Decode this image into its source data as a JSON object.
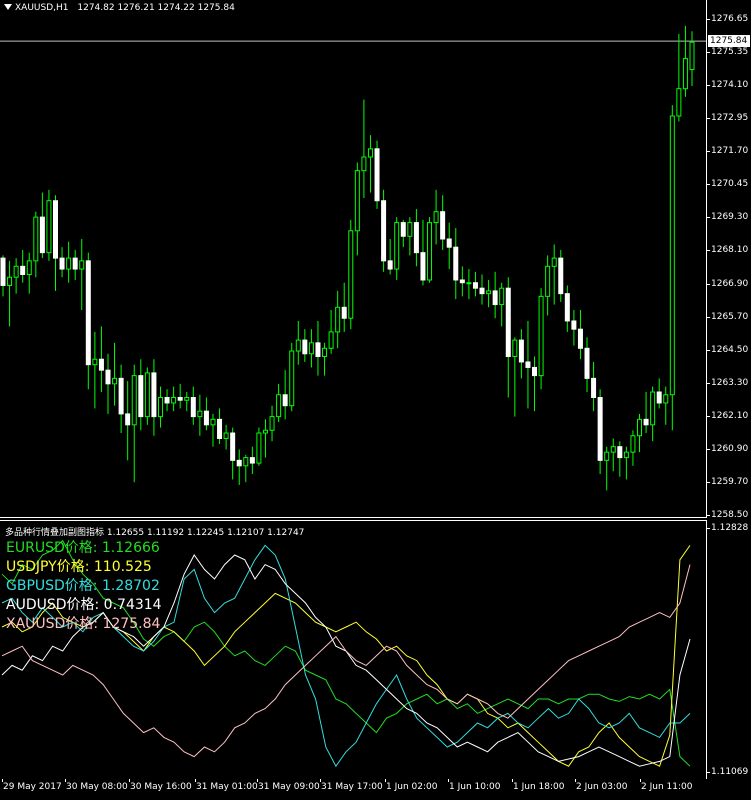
{
  "header": {
    "symbol": "XAUUSD,H1",
    "ohlc": "1274.82 1276.21 1274.22 1275.84"
  },
  "sub_header": {
    "text": "多品种行情叠加副图指标 1.12655 1.11192 1.12245 1.12107 1.12747"
  },
  "legend": [
    {
      "text": "EURUSD价格: 1.12666",
      "color": "#22dd22"
    },
    {
      "text": "USDJPY价格: 110.525",
      "color": "#ffff33"
    },
    {
      "text": "GBPUSD价格: 1.28702",
      "color": "#33dddd"
    },
    {
      "text": "AUDUSD价格: 0.74314",
      "color": "#ffffff"
    },
    {
      "text": "XAUUSD价格: 1275.84",
      "color": "#ffc0c0"
    }
  ],
  "price_axis": [
    "1276.65",
    "1275.35",
    "1274.10",
    "1272.95",
    "1271.70",
    "1270.45",
    "1269.30",
    "1268.10",
    "1266.90",
    "1265.70",
    "1264.50",
    "1263.30",
    "1262.10",
    "1260.90",
    "1259.70",
    "1258.50"
  ],
  "current_price": "1275.84",
  "sub_axis": {
    "top": "1.12828",
    "bottom": "1.11069"
  },
  "time_axis": [
    "29 May 2017",
    "30 May 08:00",
    "30 May 16:00",
    "31 May 01:00",
    "31 May 09:00",
    "31 May 17:00",
    "1 Jun 02:00",
    "1 Jun 10:00",
    "1 Jun 18:00",
    "2 Jun 03:00",
    "2 Jun 11:00"
  ],
  "colors": {
    "candle": "#00ff00",
    "background": "#000000",
    "price_line": "#c0c0c0"
  },
  "chart_data": {
    "type": "candlestick",
    "symbol": "XAUUSD",
    "timeframe": "H1",
    "ylim": [
      1258.5,
      1276.9
    ],
    "candles": [
      [
        1267.9,
        1268.0,
        1266.5,
        1266.9
      ],
      [
        1266.9,
        1267.8,
        1265.4,
        1267.2
      ],
      [
        1267.2,
        1267.9,
        1266.6,
        1267.6
      ],
      [
        1267.6,
        1268.2,
        1267.0,
        1267.3
      ],
      [
        1267.3,
        1268.1,
        1266.6,
        1267.8
      ],
      [
        1267.8,
        1269.6,
        1267.2,
        1269.4
      ],
      [
        1269.4,
        1270.3,
        1267.9,
        1268.1
      ],
      [
        1268.1,
        1270.4,
        1267.8,
        1270.0
      ],
      [
        1270.0,
        1270.2,
        1266.7,
        1267.9
      ],
      [
        1267.9,
        1268.3,
        1267.2,
        1267.5
      ],
      [
        1267.5,
        1268.5,
        1267.0,
        1267.9
      ],
      [
        1267.9,
        1268.2,
        1267.1,
        1267.5
      ],
      [
        1267.5,
        1268.6,
        1266.0,
        1267.8
      ],
      [
        1267.8,
        1268.1,
        1263.1,
        1264.0
      ],
      [
        1264.0,
        1265.2,
        1262.4,
        1264.2
      ],
      [
        1264.2,
        1265.4,
        1263.0,
        1263.8
      ],
      [
        1263.8,
        1264.4,
        1262.2,
        1263.3
      ],
      [
        1263.3,
        1264.8,
        1262.5,
        1263.5
      ],
      [
        1263.5,
        1264.0,
        1261.5,
        1262.2
      ],
      [
        1262.2,
        1263.4,
        1260.5,
        1261.8
      ],
      [
        1261.8,
        1264.0,
        1259.7,
        1263.6
      ],
      [
        1263.6,
        1264.2,
        1261.6,
        1262.1
      ],
      [
        1262.1,
        1263.9,
        1261.8,
        1263.7
      ],
      [
        1263.7,
        1264.2,
        1261.4,
        1262.1
      ],
      [
        1262.1,
        1263.2,
        1261.7,
        1262.8
      ],
      [
        1262.8,
        1263.1,
        1262.3,
        1262.6
      ],
      [
        1262.6,
        1263.2,
        1262.3,
        1262.8
      ],
      [
        1262.8,
        1263.3,
        1262.4,
        1262.7
      ],
      [
        1262.7,
        1263.0,
        1262.3,
        1262.8
      ],
      [
        1262.8,
        1263.2,
        1261.8,
        1262.1
      ],
      [
        1262.1,
        1262.9,
        1261.4,
        1262.3
      ],
      [
        1262.3,
        1262.8,
        1261.6,
        1261.8
      ],
      [
        1261.8,
        1262.2,
        1261.0,
        1262.0
      ],
      [
        1262.0,
        1262.4,
        1261.1,
        1261.3
      ],
      [
        1261.3,
        1261.8,
        1260.9,
        1261.5
      ],
      [
        1261.5,
        1261.7,
        1259.8,
        1260.5
      ],
      [
        1260.5,
        1260.9,
        1259.6,
        1260.3
      ],
      [
        1260.3,
        1260.7,
        1259.7,
        1260.6
      ],
      [
        1260.6,
        1261.0,
        1260.0,
        1260.4
      ],
      [
        1260.4,
        1261.7,
        1260.3,
        1261.5
      ],
      [
        1261.5,
        1262.0,
        1260.6,
        1261.6
      ],
      [
        1261.6,
        1262.5,
        1261.2,
        1262.1
      ],
      [
        1262.1,
        1263.3,
        1261.9,
        1262.9
      ],
      [
        1262.9,
        1263.8,
        1262.0,
        1262.5
      ],
      [
        1262.5,
        1264.8,
        1262.3,
        1264.5
      ],
      [
        1264.5,
        1265.6,
        1264.0,
        1264.9
      ],
      [
        1264.9,
        1265.3,
        1264.1,
        1264.4
      ],
      [
        1264.4,
        1265.3,
        1263.9,
        1264.8
      ],
      [
        1264.8,
        1265.6,
        1263.6,
        1264.3
      ],
      [
        1264.3,
        1264.8,
        1263.6,
        1264.6
      ],
      [
        1264.6,
        1266.0,
        1264.4,
        1265.2
      ],
      [
        1265.2,
        1266.7,
        1264.6,
        1266.1
      ],
      [
        1266.1,
        1267.0,
        1265.2,
        1265.7
      ],
      [
        1265.7,
        1269.3,
        1265.3,
        1268.9
      ],
      [
        1268.9,
        1271.4,
        1268.0,
        1271.1
      ],
      [
        1271.1,
        1273.7,
        1270.1,
        1271.6
      ],
      [
        1271.6,
        1272.4,
        1270.3,
        1271.9
      ],
      [
        1271.9,
        1272.2,
        1269.7,
        1270.0
      ],
      [
        1270.0,
        1270.4,
        1267.4,
        1267.8
      ],
      [
        1267.8,
        1268.6,
        1267.3,
        1267.5
      ],
      [
        1267.5,
        1269.4,
        1267.1,
        1269.2
      ],
      [
        1269.2,
        1269.3,
        1268.3,
        1268.7
      ],
      [
        1268.7,
        1269.4,
        1268.0,
        1269.2
      ],
      [
        1269.2,
        1269.7,
        1267.6,
        1268.1
      ],
      [
        1268.1,
        1269.3,
        1266.9,
        1267.1
      ],
      [
        1267.1,
        1269.4,
        1267.0,
        1269.2
      ],
      [
        1269.2,
        1270.4,
        1268.4,
        1269.6
      ],
      [
        1269.6,
        1270.2,
        1268.2,
        1268.6
      ],
      [
        1268.6,
        1269.2,
        1267.5,
        1268.3
      ],
      [
        1268.3,
        1269.0,
        1266.4,
        1267.1
      ],
      [
        1267.1,
        1267.6,
        1266.5,
        1267.0
      ],
      [
        1267.0,
        1267.5,
        1266.4,
        1267.0
      ],
      [
        1267.0,
        1267.4,
        1266.5,
        1266.8
      ],
      [
        1266.8,
        1267.3,
        1266.2,
        1266.6
      ],
      [
        1266.6,
        1267.1,
        1266.1,
        1266.7
      ],
      [
        1266.7,
        1267.4,
        1265.7,
        1266.2
      ],
      [
        1266.2,
        1267.0,
        1265.4,
        1266.8
      ],
      [
        1266.8,
        1267.2,
        1262.8,
        1264.3
      ],
      [
        1264.3,
        1265.0,
        1262.1,
        1264.9
      ],
      [
        1264.9,
        1265.3,
        1263.5,
        1264.1
      ],
      [
        1264.1,
        1265.6,
        1262.4,
        1263.9
      ],
      [
        1263.9,
        1264.3,
        1262.3,
        1263.6
      ],
      [
        1263.6,
        1266.8,
        1263.1,
        1266.5
      ],
      [
        1266.5,
        1268.0,
        1265.8,
        1267.6
      ],
      [
        1267.6,
        1268.4,
        1266.2,
        1267.9
      ],
      [
        1267.9,
        1268.2,
        1266.3,
        1266.6
      ],
      [
        1266.6,
        1266.9,
        1265.2,
        1265.6
      ],
      [
        1265.6,
        1266.0,
        1264.7,
        1265.3
      ],
      [
        1265.3,
        1266.0,
        1264.2,
        1264.6
      ],
      [
        1264.6,
        1265.0,
        1263.0,
        1263.5
      ],
      [
        1263.5,
        1264.1,
        1262.3,
        1262.8
      ],
      [
        1262.8,
        1263.1,
        1260.0,
        1260.5
      ],
      [
        1260.5,
        1261.0,
        1259.4,
        1260.8
      ],
      [
        1260.8,
        1261.3,
        1260.1,
        1261.0
      ],
      [
        1261.0,
        1261.2,
        1259.9,
        1260.6
      ],
      [
        1260.6,
        1261.0,
        1259.8,
        1260.8
      ],
      [
        1260.8,
        1261.6,
        1260.3,
        1261.4
      ],
      [
        1261.4,
        1262.2,
        1260.8,
        1262.0
      ],
      [
        1262.0,
        1263.0,
        1261.5,
        1261.8
      ],
      [
        1261.8,
        1263.2,
        1261.2,
        1263.0
      ],
      [
        1263.0,
        1263.5,
        1262.4,
        1262.6
      ],
      [
        1262.6,
        1263.2,
        1261.8,
        1262.9
      ],
      [
        1262.9,
        1273.5,
        1261.6,
        1273.1
      ],
      [
        1273.1,
        1276.1,
        1272.9,
        1274.1
      ],
      [
        1274.1,
        1276.4,
        1273.8,
        1275.2
      ],
      [
        1274.8,
        1276.2,
        1274.2,
        1275.8
      ]
    ],
    "overlay": {
      "title": "多品种行情叠加副图指标",
      "values": [
        1.12655,
        1.11192,
        1.12245,
        1.12107,
        1.12747
      ],
      "ylim": [
        1.11069,
        1.12828
      ],
      "series": [
        {
          "name": "EURUSD",
          "color": "#22dd22",
          "points": [
            0.82,
            0.78,
            0.86,
            0.84,
            0.9,
            0.92,
            0.96,
            0.88,
            0.82,
            0.78,
            0.72,
            0.7,
            0.68,
            0.62,
            0.55,
            0.52,
            0.56,
            0.58,
            0.54,
            0.6,
            0.62,
            0.58,
            0.52,
            0.48,
            0.5,
            0.46,
            0.44,
            0.48,
            0.52,
            0.5,
            0.42,
            0.4,
            0.38,
            0.3,
            0.28,
            0.24,
            0.2,
            0.16,
            0.22,
            0.24,
            0.28,
            0.3,
            0.32,
            0.28,
            0.3,
            0.26,
            0.28,
            0.24,
            0.26,
            0.28,
            0.3,
            0.28,
            0.26,
            0.3,
            0.3,
            0.28,
            0.3,
            0.3,
            0.32,
            0.32,
            0.3,
            0.29,
            0.31,
            0.3,
            0.32,
            0.3,
            0.34,
            0.06,
            0.02
          ]
        },
        {
          "name": "USDJPY",
          "color": "#ffff33",
          "points": [
            0.6,
            0.62,
            0.58,
            0.6,
            0.66,
            0.7,
            0.64,
            0.62,
            0.6,
            0.62,
            0.66,
            0.6,
            0.58,
            0.54,
            0.5,
            0.56,
            0.6,
            0.58,
            0.54,
            0.5,
            0.44,
            0.48,
            0.52,
            0.58,
            0.62,
            0.66,
            0.7,
            0.74,
            0.72,
            0.7,
            0.66,
            0.62,
            0.6,
            0.58,
            0.6,
            0.62,
            0.58,
            0.55,
            0.5,
            0.52,
            0.48,
            0.46,
            0.4,
            0.36,
            0.3,
            0.28,
            0.32,
            0.3,
            0.24,
            0.22,
            0.18,
            0.2,
            0.16,
            0.12,
            0.08,
            0.04,
            0.02,
            0.08,
            0.1,
            0.16,
            0.2,
            0.14,
            0.1,
            0.06,
            0.04,
            0.02,
            0.15,
            0.88,
            0.94
          ]
        },
        {
          "name": "GBPUSD",
          "color": "#33dddd",
          "points": [
            0.7,
            0.72,
            0.66,
            0.62,
            0.68,
            0.64,
            0.6,
            0.62,
            0.58,
            0.64,
            0.66,
            0.6,
            0.56,
            0.52,
            0.5,
            0.54,
            0.6,
            0.62,
            0.8,
            0.84,
            0.72,
            0.66,
            0.7,
            0.72,
            0.8,
            0.88,
            0.94,
            0.9,
            0.8,
            0.6,
            0.4,
            0.3,
            0.1,
            0.02,
            0.08,
            0.12,
            0.2,
            0.28,
            0.34,
            0.4,
            0.3,
            0.22,
            0.18,
            0.14,
            0.1,
            0.12,
            0.16,
            0.2,
            0.18,
            0.22,
            0.24,
            0.2,
            0.18,
            0.22,
            0.26,
            0.22,
            0.24,
            0.3,
            0.26,
            0.2,
            0.18,
            0.2,
            0.24,
            0.18,
            0.16,
            0.14,
            0.2,
            0.2,
            0.24
          ]
        },
        {
          "name": "AUDUSD",
          "color": "#ffffff",
          "points": [
            0.4,
            0.44,
            0.42,
            0.48,
            0.46,
            0.52,
            0.5,
            0.56,
            0.6,
            0.62,
            0.66,
            0.6,
            0.58,
            0.56,
            0.52,
            0.56,
            0.6,
            0.7,
            0.82,
            0.9,
            0.84,
            0.8,
            0.86,
            0.9,
            0.88,
            0.8,
            0.86,
            0.84,
            0.78,
            0.74,
            0.7,
            0.64,
            0.6,
            0.52,
            0.5,
            0.44,
            0.42,
            0.38,
            0.34,
            0.3,
            0.26,
            0.24,
            0.2,
            0.18,
            0.14,
            0.1,
            0.12,
            0.1,
            0.08,
            0.12,
            0.14,
            0.16,
            0.12,
            0.08,
            0.06,
            0.04,
            0.05,
            0.06,
            0.08,
            0.1,
            0.08,
            0.06,
            0.04,
            0.02,
            0.03,
            0.04,
            0.06,
            0.4,
            0.55
          ]
        },
        {
          "name": "XAUUSD",
          "color": "#ffc0c0",
          "points": [
            0.48,
            0.5,
            0.52,
            0.46,
            0.44,
            0.42,
            0.4,
            0.44,
            0.42,
            0.4,
            0.36,
            0.3,
            0.24,
            0.2,
            0.16,
            0.18,
            0.14,
            0.12,
            0.08,
            0.06,
            0.1,
            0.08,
            0.12,
            0.18,
            0.2,
            0.24,
            0.26,
            0.3,
            0.36,
            0.4,
            0.44,
            0.48,
            0.52,
            0.56,
            0.5,
            0.46,
            0.44,
            0.48,
            0.52,
            0.5,
            0.44,
            0.4,
            0.36,
            0.34,
            0.3,
            0.28,
            0.32,
            0.3,
            0.28,
            0.24,
            0.22,
            0.26,
            0.3,
            0.34,
            0.38,
            0.42,
            0.46,
            0.48,
            0.5,
            0.52,
            0.54,
            0.56,
            0.6,
            0.62,
            0.64,
            0.66,
            0.64,
            0.7,
            0.86
          ]
        }
      ]
    }
  }
}
